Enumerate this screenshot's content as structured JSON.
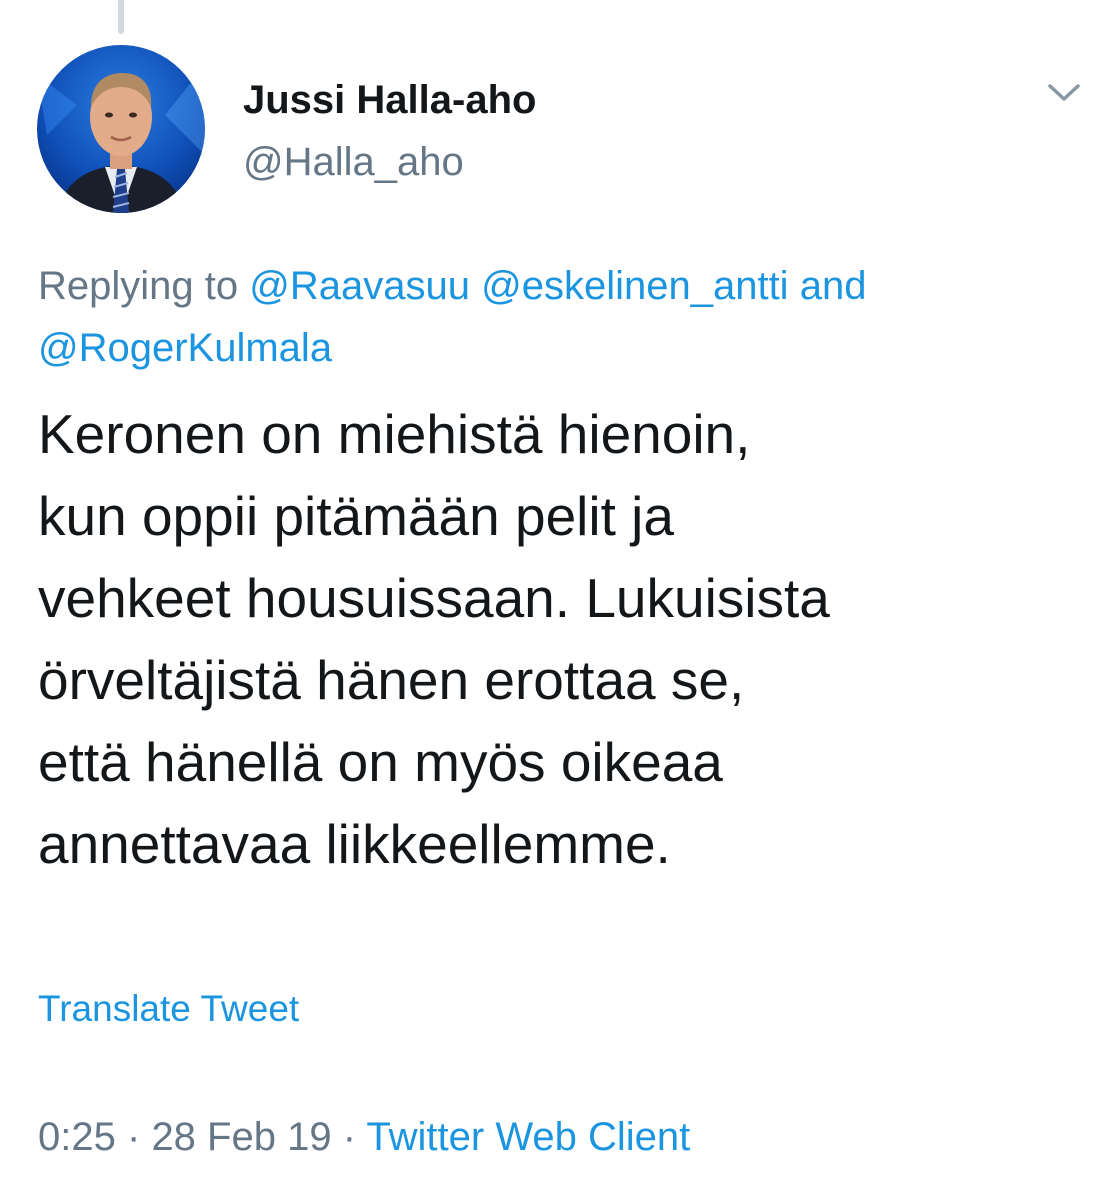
{
  "user": {
    "display_name": "Jussi Halla-aho",
    "handle": "@Halla_aho"
  },
  "reply": {
    "prefix": "Replying to",
    "mentions": [
      "@Raavasuu",
      "@eskelinen_antti",
      "@RogerKulmala"
    ],
    "conjunction": "and"
  },
  "tweet": {
    "lines": [
      "Keronen on miehistä hienoin,",
      "kun oppii pitämään pelit ja",
      "vehkeet housuissaan. Lukuisista",
      "örveltäjistä hänen erottaa se,",
      "että hänellä on myös oikeaa",
      "annettavaa liikkeellemme."
    ]
  },
  "translate_label": "Translate Tweet",
  "meta": {
    "time": "0:25",
    "separator": "·",
    "date": "28 Feb 19",
    "source": "Twitter Web Client"
  },
  "icons": {
    "avatar": "profile-photo",
    "menu": "chevron-down-icon"
  },
  "colors": {
    "link": "#1b95e0",
    "secondary_text": "#657786",
    "primary_text": "#14171a",
    "thread_line": "#cfd9de"
  }
}
